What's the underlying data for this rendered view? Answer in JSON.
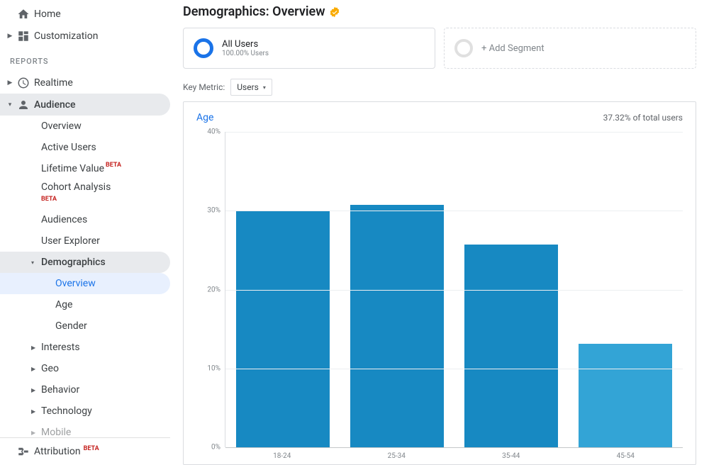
{
  "sidebar": {
    "home": "Home",
    "customization": "Customization",
    "reports_heading": "REPORTS",
    "realtime": "Realtime",
    "audience": "Audience",
    "audience_items": {
      "overview": "Overview",
      "active_users": "Active Users",
      "lifetime_value": "Lifetime Value",
      "lifetime_value_badge": "BETA",
      "cohort": "Cohort Analysis",
      "cohort_badge": "BETA",
      "audiences": "Audiences",
      "user_explorer": "User Explorer",
      "demographics": "Demographics",
      "demo_overview": "Overview",
      "demo_age": "Age",
      "demo_gender": "Gender",
      "interests": "Interests",
      "geo": "Geo",
      "behavior": "Behavior",
      "technology": "Technology",
      "mobile": "Mobile"
    },
    "attribution": "Attribution",
    "attribution_badge": "BETA"
  },
  "page": {
    "title": "Demographics: Overview"
  },
  "segments": {
    "all_users_title": "All Users",
    "all_users_sub": "100.00% Users",
    "add_segment": "+ Add Segment"
  },
  "key_metric": {
    "label": "Key Metric:",
    "selected": "Users"
  },
  "chart_header": {
    "title": "Age",
    "subtitle": "37.32% of total users"
  },
  "chart_data": {
    "type": "bar",
    "title": "Age",
    "xlabel": "",
    "ylabel": "",
    "ylim": [
      0,
      40
    ],
    "y_ticks": [
      "40%",
      "30%",
      "20%",
      "10%",
      "0%"
    ],
    "categories": [
      "18-24",
      "25-34",
      "35-44",
      "45-54"
    ],
    "values": [
      30.0,
      30.7,
      25.7,
      13.1
    ],
    "colors": [
      "#1789c2",
      "#1789c2",
      "#1789c2",
      "#33a4d6"
    ],
    "grid": true
  }
}
